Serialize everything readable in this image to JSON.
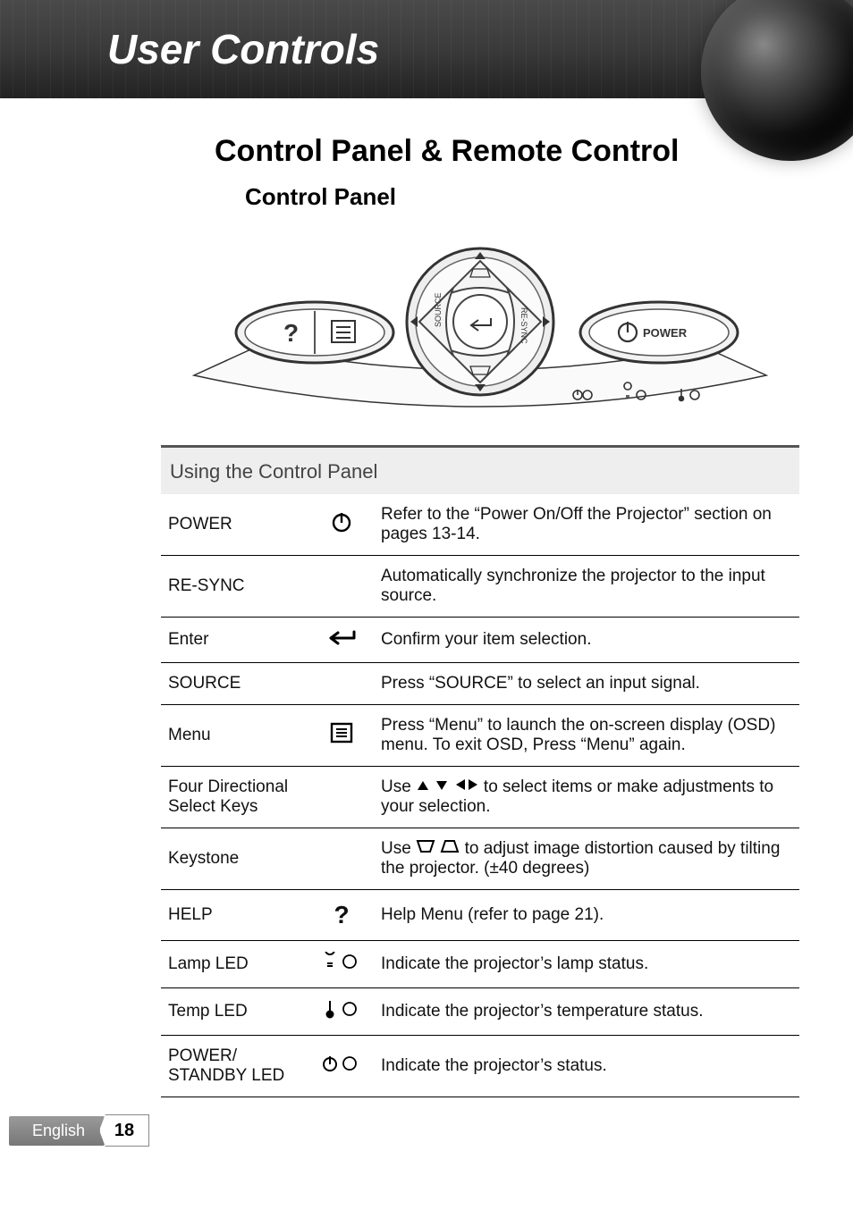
{
  "header": {
    "title": "User Controls"
  },
  "main": {
    "h1": "Control Panel & Remote Control",
    "h2": "Control Panel",
    "table_title": "Using the Control Panel",
    "diagram": {
      "help_label": "?",
      "menu_label": "menu-icon",
      "dpad": {
        "left_text": "SOURCE",
        "right_text": "RE-SYNC"
      },
      "power_label": "POWER"
    },
    "rows": [
      {
        "name": "POWER",
        "icon": "power-icon",
        "desc": "Refer to the “Power On/Off the Projector” section on pages 13-14."
      },
      {
        "name": "RE-SYNC",
        "icon": "",
        "desc": "Automatically synchronize the projector to the input source."
      },
      {
        "name": "Enter",
        "icon": "enter-icon",
        "desc": "Confirm your item selection."
      },
      {
        "name": "SOURCE",
        "icon": "",
        "desc": "Press “SOURCE” to select an input signal."
      },
      {
        "name": "Menu",
        "icon": "menu-icon",
        "desc": "Press “Menu” to launch the on-screen display (OSD) menu. To exit OSD, Press “Menu” again."
      },
      {
        "name": "Four Directional Select Keys",
        "icon": "",
        "desc_pre": "Use ",
        "desc_post": " to select items or make adjustments to your selection.",
        "inline_icons": "arrows"
      },
      {
        "name": "Keystone",
        "icon": "",
        "desc_pre": "Use ",
        "desc_post": " to adjust image distortion caused by tilting the projector. (±40 degrees)",
        "inline_icons": "keystone"
      },
      {
        "name": "HELP",
        "icon": "help-icon",
        "desc": "Help Menu (refer to page 21)."
      },
      {
        "name": "Lamp LED",
        "icon": "lamp-led-icon",
        "desc": "Indicate the projector’s lamp status."
      },
      {
        "name": "Temp LED",
        "icon": "temp-led-icon",
        "desc": "Indicate the projector’s temperature status."
      },
      {
        "name": "POWER/\nSTANDBY LED",
        "icon": "power-led-icon",
        "desc": "Indicate the projector’s status."
      }
    ]
  },
  "footer": {
    "language": "English",
    "page": "18"
  }
}
